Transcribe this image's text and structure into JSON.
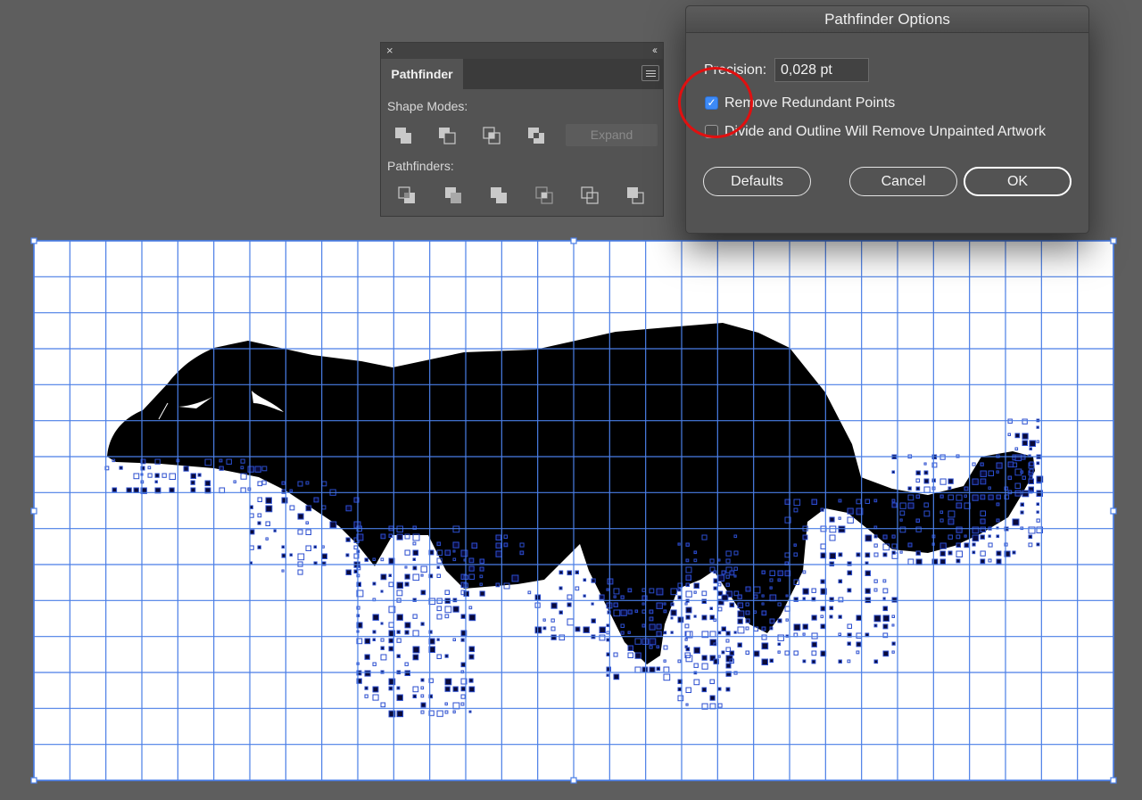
{
  "pathfinder_panel": {
    "close_glyph": "×",
    "collapse_glyph": "‹‹",
    "tab_label": "Pathfinder",
    "shape_modes_label": "Shape Modes:",
    "pathfinders_label": "Pathfinders:",
    "expand_label": "Expand",
    "shape_mode_buttons": [
      "unite",
      "minus-front",
      "intersect",
      "exclude"
    ],
    "pathfinder_buttons": [
      "divide",
      "trim",
      "merge",
      "crop",
      "outline",
      "minus-back"
    ]
  },
  "dialog": {
    "title": "Pathfinder Options",
    "precision_label": "Precision:",
    "precision_value": "0,028 pt",
    "remove_redundant_label": "Remove Redundant Points",
    "remove_redundant_checked": true,
    "divide_outline_label": "Divide and Outline Will Remove Unpainted Artwork",
    "divide_outline_checked": false,
    "defaults_label": "Defaults",
    "cancel_label": "Cancel",
    "ok_label": "OK"
  },
  "artwork": {
    "grid_color": "#4a7ee6",
    "fill_color": "#000000",
    "background_color": "#ffffff",
    "description_icon": "panther-silhouette"
  },
  "colors": {
    "ui_background": "#5e5e5e",
    "panel": "#535353",
    "checkbox_accent": "#3d8af7",
    "annotation": "#e01010"
  }
}
